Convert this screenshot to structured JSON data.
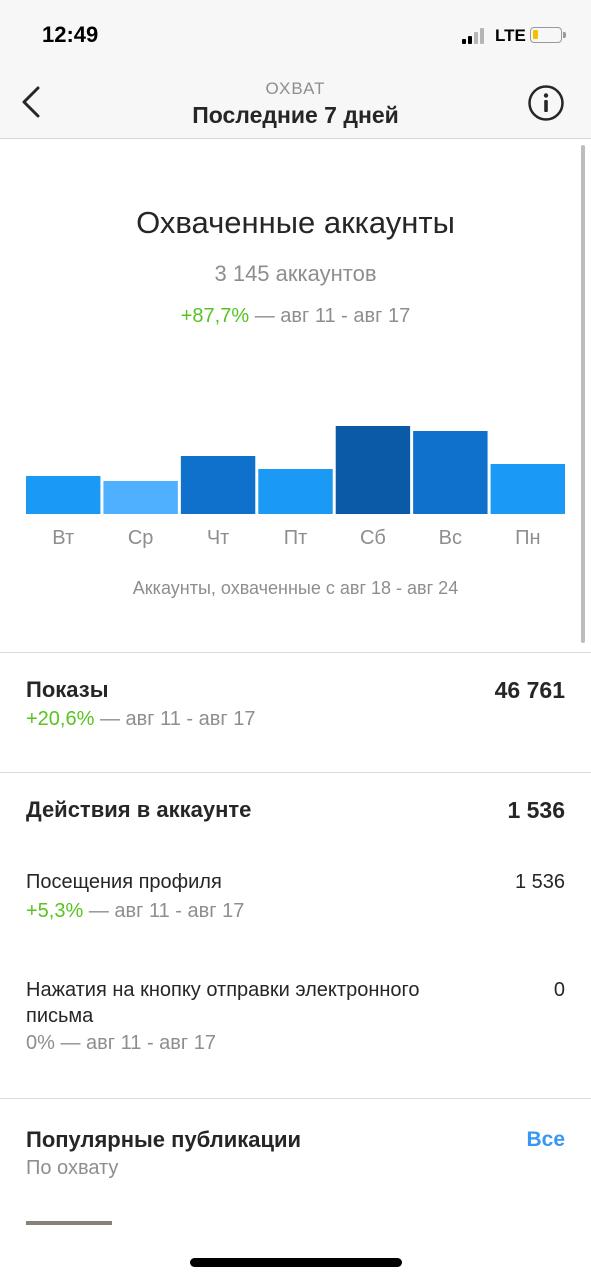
{
  "status_bar": {
    "time": "12:49",
    "network": "LTE"
  },
  "nav": {
    "super_title": "ОХВАТ",
    "title": "Последние 7 дней",
    "back_icon": "chevron-left-icon",
    "info_icon": "info-icon"
  },
  "reach": {
    "title": "Охваченные аккаунты",
    "count": "3 145 аккаунтов",
    "change": "+87,7%",
    "change_period": " — авг 11 - авг 17",
    "caption": "Аккаунты, охваченные с авг 18 - авг 24"
  },
  "chart_data": {
    "type": "bar",
    "categories": [
      "Вт",
      "Ср",
      "Чт",
      "Пт",
      "Сб",
      "Вс",
      "Пн"
    ],
    "values": [
      38,
      33,
      58,
      45,
      88,
      83,
      50
    ],
    "colors": [
      "#1a9af5",
      "#4fb0ff",
      "#0f71cc",
      "#1a9af5",
      "#0a5aa8",
      "#0f71cc",
      "#1a9af5"
    ],
    "title": "",
    "xlabel": "",
    "ylabel": ""
  },
  "impressions": {
    "title": "Показы",
    "value": "46 761",
    "change": "+20,6%",
    "change_period": " — авг 11 - авг 17"
  },
  "actions": {
    "title": "Действия в аккаунте",
    "value": "1 536",
    "items": [
      {
        "label": "Посещения профиля",
        "value": "1 536",
        "change": "+5,3%",
        "change_period": " — авг 11 - авг 17"
      },
      {
        "label_line1": "Нажатия на кнопку отправки электронного",
        "label_line2": "письма",
        "value": "0",
        "change": "0% — авг 11 - авг 17"
      }
    ]
  },
  "popular": {
    "title": "Популярные публикации",
    "subtitle": "По охвату",
    "see_all": "Все"
  },
  "colors": {
    "accent": "#3897f0",
    "positive": "#58c322",
    "muted": "#8e8e8e",
    "text": "#262626"
  }
}
